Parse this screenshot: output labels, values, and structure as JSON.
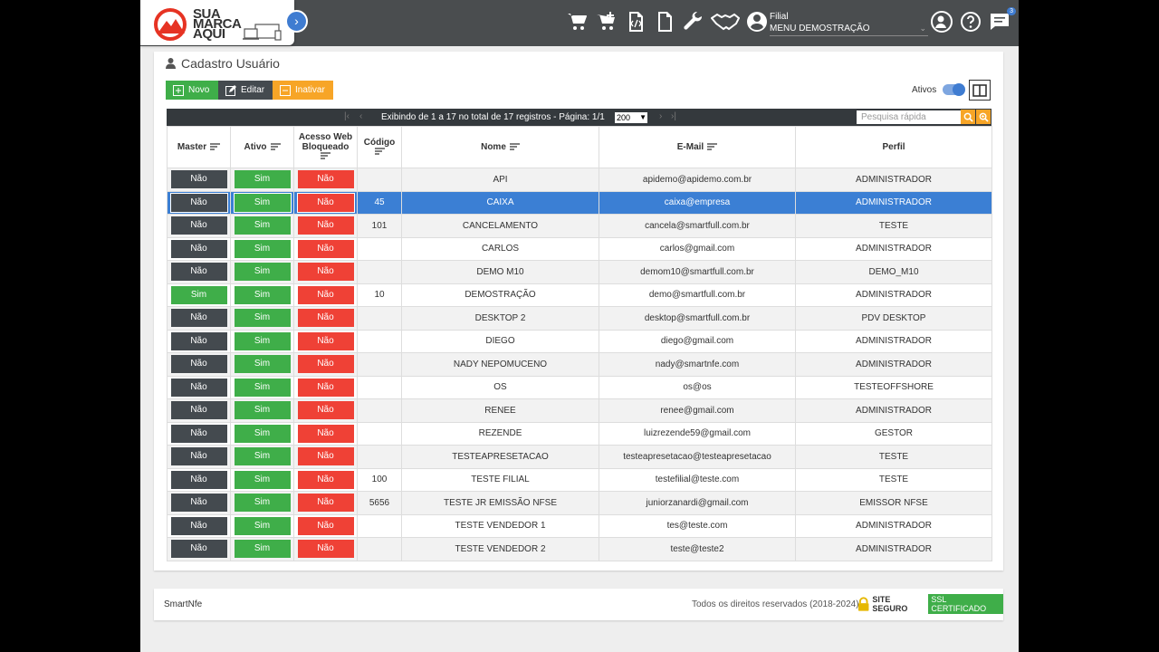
{
  "brand": {
    "logo_line1": "SUA",
    "logo_line2": "MARCA",
    "logo_line3": "AQUI"
  },
  "header": {
    "filial_label": "Filial",
    "filial_value": "MENU DEMOSTRAÇÃO",
    "notification_count": "3",
    "icons": [
      "cart-icon",
      "cart-add-icon",
      "code-file-icon",
      "file-icon",
      "wrench-icon",
      "handshake-icon",
      "user-circle-icon",
      "support-agent-icon",
      "help-icon",
      "chat-icon"
    ]
  },
  "page": {
    "title": "Cadastro Usuário"
  },
  "toolbar": {
    "novo_label": "Novo",
    "editar_label": "Editar",
    "inativar_label": "Inativar",
    "ativos_label": "Ativos",
    "ativos_on": true
  },
  "pager": {
    "info": "Exibindo de 1 a 17 no total de 17 registros - Página: 1/1",
    "page_size": "200",
    "search_placeholder": "Pesquisa rápida"
  },
  "table": {
    "columns": {
      "master": "Master",
      "ativo": "Ativo",
      "acesso_line1": "Acesso Web",
      "acesso_line2": "Bloqueado",
      "codigo": "Código",
      "nome": "Nome",
      "email": "E-Mail",
      "perfil": "Perfil"
    },
    "selected_index": 1,
    "rows": [
      {
        "master": "Não",
        "ativo": "Sim",
        "bloqueado": "Não",
        "codigo": "",
        "nome": "API",
        "email": "apidemo@apidemo.com.br",
        "perfil": "ADMINISTRADOR"
      },
      {
        "master": "Não",
        "ativo": "Sim",
        "bloqueado": "Não",
        "codigo": "45",
        "nome": "CAIXA",
        "email": "caixa@empresa",
        "perfil": "ADMINISTRADOR"
      },
      {
        "master": "Não",
        "ativo": "Sim",
        "bloqueado": "Não",
        "codigo": "101",
        "nome": "CANCELAMENTO",
        "email": "cancela@smartfull.com.br",
        "perfil": "TESTE"
      },
      {
        "master": "Não",
        "ativo": "Sim",
        "bloqueado": "Não",
        "codigo": "",
        "nome": "CARLOS",
        "email": "carlos@gmail.com",
        "perfil": "ADMINISTRADOR"
      },
      {
        "master": "Não",
        "ativo": "Sim",
        "bloqueado": "Não",
        "codigo": "",
        "nome": "DEMO M10",
        "email": "demom10@smartfull.com.br",
        "perfil": "DEMO_M10"
      },
      {
        "master": "Sim",
        "ativo": "Sim",
        "bloqueado": "Não",
        "codigo": "10",
        "nome": "DEMOSTRAÇÃO",
        "email": "demo@smartfull.com.br",
        "perfil": "ADMINISTRADOR"
      },
      {
        "master": "Não",
        "ativo": "Sim",
        "bloqueado": "Não",
        "codigo": "",
        "nome": "DESKTOP 2",
        "email": "desktop@smartfull.com.br",
        "perfil": "PDV DESKTOP"
      },
      {
        "master": "Não",
        "ativo": "Sim",
        "bloqueado": "Não",
        "codigo": "",
        "nome": "DIEGO",
        "email": "diego@gmail.com",
        "perfil": "ADMINISTRADOR"
      },
      {
        "master": "Não",
        "ativo": "Sim",
        "bloqueado": "Não",
        "codigo": "",
        "nome": "NADY NEPOMUCENO",
        "email": "nady@smartnfe.com",
        "perfil": "ADMINISTRADOR"
      },
      {
        "master": "Não",
        "ativo": "Sim",
        "bloqueado": "Não",
        "codigo": "",
        "nome": "OS",
        "email": "os@os",
        "perfil": "TESTEOFFSHORE"
      },
      {
        "master": "Não",
        "ativo": "Sim",
        "bloqueado": "Não",
        "codigo": "",
        "nome": "RENEE",
        "email": "renee@gmail.com",
        "perfil": "ADMINISTRADOR"
      },
      {
        "master": "Não",
        "ativo": "Sim",
        "bloqueado": "Não",
        "codigo": "",
        "nome": "REZENDE",
        "email": "luizrezende59@gmail.com",
        "perfil": "GESTOR"
      },
      {
        "master": "Não",
        "ativo": "Sim",
        "bloqueado": "Não",
        "codigo": "",
        "nome": "TESTEAPRESETACAO",
        "email": "testeapresetacao@testeapresetacao",
        "perfil": "TESTE"
      },
      {
        "master": "Não",
        "ativo": "Sim",
        "bloqueado": "Não",
        "codigo": "100",
        "nome": "TESTE FILIAL",
        "email": "testefilial@teste.com",
        "perfil": "TESTE"
      },
      {
        "master": "Não",
        "ativo": "Sim",
        "bloqueado": "Não",
        "codigo": "5656",
        "nome": "TESTE JR EMISSÃO NFSE",
        "email": "juniorzanardi@gmail.com",
        "perfil": "EMISSOR NFSE"
      },
      {
        "master": "Não",
        "ativo": "Sim",
        "bloqueado": "Não",
        "codigo": "",
        "nome": "TESTE VENDEDOR 1",
        "email": "tes@teste.com",
        "perfil": "ADMINISTRADOR"
      },
      {
        "master": "Não",
        "ativo": "Sim",
        "bloqueado": "Não",
        "codigo": "",
        "nome": "TESTE VENDEDOR 2",
        "email": "teste@teste2",
        "perfil": "ADMINISTRADOR"
      }
    ]
  },
  "footer": {
    "brand": "SmartNfe",
    "rights": "Todos os direitos reservados (2018-2024)",
    "ssl_text": "SITE SEGURO",
    "ssl_badge": "SSL CERTIFICADO"
  },
  "colors": {
    "accent": "#3b7fd4",
    "green": "#3fae49",
    "red": "#ef4136",
    "dark": "#444a4f",
    "orange": "#f7a527"
  }
}
